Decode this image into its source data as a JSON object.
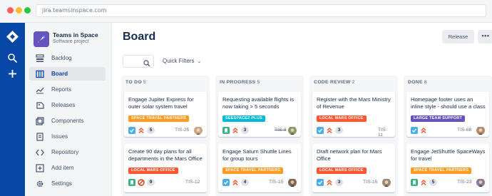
{
  "browser": {
    "url": "jira.teamsinspace.com"
  },
  "project": {
    "name": "Teams in Space",
    "type": "Software project"
  },
  "sidebar": {
    "items": [
      {
        "label": "Backlog",
        "icon": "backlog-icon"
      },
      {
        "label": "Board",
        "icon": "board-icon",
        "active": true
      },
      {
        "label": "Reports",
        "icon": "reports-icon"
      },
      {
        "label": "Releases",
        "icon": "releases-icon"
      },
      {
        "label": "Components",
        "icon": "components-icon"
      },
      {
        "label": "Issues",
        "icon": "issues-icon"
      },
      {
        "label": "Repository",
        "icon": "repository-icon"
      },
      {
        "label": "Add item",
        "icon": "add-item-icon"
      },
      {
        "label": "Settings",
        "icon": "settings-icon"
      }
    ]
  },
  "page": {
    "title": "Board",
    "release_label": "Release",
    "more_label": "•••"
  },
  "filters": {
    "quick_filters_label": "Quick Filters"
  },
  "colors": {
    "epic_space_travel": "#ff991f",
    "epic_local_mars": "#ff5630",
    "epic_seespacez": "#00b8d9",
    "epic_large_team": "#6554c0",
    "story": "#36b37e",
    "task": "#4bade8",
    "blocker": "#de350b",
    "priority_high": "#ff5630"
  },
  "columns": [
    {
      "name": "TO DO",
      "count": "5",
      "cards": [
        {
          "title": "Engage Jupiter Express for outer solar system travel",
          "epic": "SPACE TRAVEL PARTNERS",
          "epic_color": "#ff991f",
          "type": "task",
          "priority": "high",
          "points": "5",
          "key": "TIS-25",
          "done": false
        },
        {
          "title": "Create 90 day plans for all departments in the Mars Office",
          "epic": "LOCAL MARS OFFICE",
          "epic_color": "#ff5630",
          "type": "story",
          "priority": "blocker",
          "points": "9",
          "key": "TIS-12",
          "done": false
        }
      ]
    },
    {
      "name": "IN PROGRESS",
      "count": "5",
      "cards": [
        {
          "title": "Requesting available flights is now taking > 5 seconds",
          "epic": "SEESPACEZ PLUS",
          "epic_color": "#00b8d9",
          "type": "story",
          "priority": "high",
          "points": "3",
          "key": "TIS-8",
          "done": true
        },
        {
          "title": "Engage Saturn Shuttle Lines for group tours",
          "epic": "SPACE TRAVEL PARTNERS",
          "epic_color": "#ff991f",
          "type": "task",
          "priority": "high",
          "points": "4",
          "key": "TIS-15",
          "done": false
        }
      ]
    },
    {
      "name": "CODE REVIEW",
      "count": "2",
      "cards": [
        {
          "title": "Register with the Mars Ministry of Revenue",
          "epic": "LOCAL MARS OFFICE",
          "epic_color": "#ff5630",
          "type": "task",
          "priority": "high",
          "points": "3",
          "key": "TIS-11",
          "done": false
        },
        {
          "title": "Draft network plan for Mars Office",
          "epic": "LOCAL MARS OFFICE",
          "epic_color": "#ff5630",
          "type": "task",
          "priority": "high",
          "points": "3",
          "key": "TIS-15",
          "done": false
        }
      ]
    },
    {
      "name": "DONE",
      "count": "8",
      "cards": [
        {
          "title": "Homepage footer uses an inline style - should use a class",
          "epic": "LARGE TEAM SUPPORT",
          "epic_color": "#6554c0",
          "type": "task",
          "priority": "high",
          "points": "",
          "key": "TIS-68",
          "done": false
        },
        {
          "title": "Engage JetShuttle SpaceWays for travel",
          "epic": "SPACE TRAVEL PARTNERS",
          "epic_color": "#ff991f",
          "type": "story",
          "priority": "high",
          "points": "5",
          "key": "TIS-23",
          "done": false
        }
      ]
    }
  ]
}
